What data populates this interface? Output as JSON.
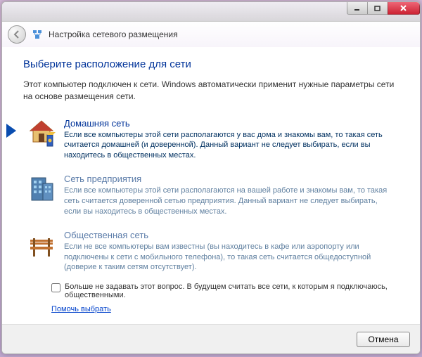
{
  "nav": {
    "title": "Настройка сетевого размещения"
  },
  "heading": "Выберите расположение для сети",
  "intro": "Этот компьютер подключен к сети. Windows автоматически применит нужные параметры сети на основе размещения сети.",
  "options": {
    "home": {
      "title": "Домашняя сеть",
      "desc": "Если все компьютеры этой сети располагаются у вас дома и знакомы вам, то такая сеть считается домашней (и доверенной). Данный вариант не следует выбирать, если вы находитесь в общественных местах."
    },
    "work": {
      "title": "Сеть предприятия",
      "desc": "Если все компьютеры этой сети располагаются на вашей работе и знакомы вам, то такая сеть считается доверенной сетью предприятия. Данный вариант не следует выбирать, если вы находитесь в общественных местах."
    },
    "public": {
      "title": "Общественная сеть",
      "desc": "Если не все компьютеры вам известны (вы находитесь в кафе или аэропорту или подключены к сети с мобильного телефона), то такая сеть считается общедоступной (доверие к таким сетям отсутствует)."
    }
  },
  "checkbox_label": "Больше не задавать этот вопрос. В будущем считать все сети, к которым я подключаюсь, общественными.",
  "help_link": "Помочь выбрать",
  "footer": {
    "cancel": "Отмена"
  }
}
